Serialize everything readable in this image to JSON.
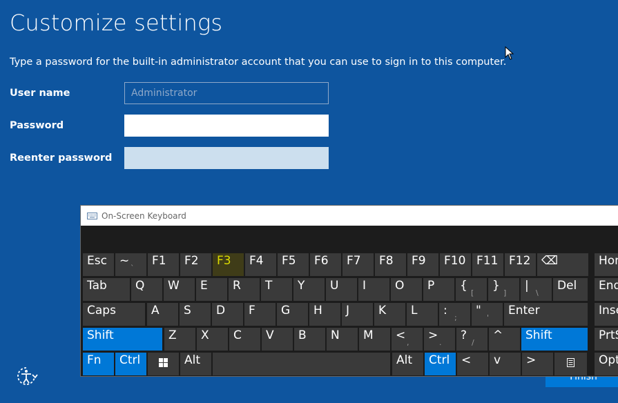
{
  "page": {
    "title": "Customize settings",
    "description": "Type a password for the built-in administrator account that you can use to sign in to this computer."
  },
  "form": {
    "user_label": "User name",
    "user_placeholder": "Administrator",
    "password_label": "Password",
    "password_value": "",
    "reenter_label": "Reenter password",
    "reenter_value": ""
  },
  "finish_label": "Finish",
  "icons": {
    "accessibility": "ease-of-access-icon",
    "cursor": "mouse-pointer-icon"
  },
  "osk": {
    "title": "On-Screen Keyboard",
    "highlighted_key": "F3",
    "rows": [
      [
        {
          "label": "Esc"
        },
        {
          "label": "~",
          "sub": "`"
        },
        {
          "label": "F1"
        },
        {
          "label": "F2"
        },
        {
          "label": "F3",
          "style": "yellow"
        },
        {
          "label": "F4"
        },
        {
          "label": "F5"
        },
        {
          "label": "F6"
        },
        {
          "label": "F7"
        },
        {
          "label": "F8"
        },
        {
          "label": "F9"
        },
        {
          "label": "F10"
        },
        {
          "label": "F11"
        },
        {
          "label": "F12"
        },
        {
          "label": "⌫",
          "name": "backspace"
        },
        {
          "label": "Home"
        }
      ],
      [
        {
          "label": "Tab"
        },
        {
          "label": "Q"
        },
        {
          "label": "W"
        },
        {
          "label": "E"
        },
        {
          "label": "R"
        },
        {
          "label": "T"
        },
        {
          "label": "Y"
        },
        {
          "label": "U"
        },
        {
          "label": "I"
        },
        {
          "label": "O"
        },
        {
          "label": "P"
        },
        {
          "label": "{",
          "sub": "["
        },
        {
          "label": "}",
          "sub": "]"
        },
        {
          "label": "|",
          "sub": "\\"
        },
        {
          "label": "Del"
        },
        {
          "label": "End"
        }
      ],
      [
        {
          "label": "Caps"
        },
        {
          "label": "A"
        },
        {
          "label": "S"
        },
        {
          "label": "D"
        },
        {
          "label": "F"
        },
        {
          "label": "G"
        },
        {
          "label": "H"
        },
        {
          "label": "J"
        },
        {
          "label": "K"
        },
        {
          "label": "L"
        },
        {
          "label": ":",
          "sub": ";"
        },
        {
          "label": "\"",
          "sub": "'"
        },
        {
          "label": "Enter"
        },
        {
          "label": "Insert"
        }
      ],
      [
        {
          "label": "Shift",
          "style": "blue"
        },
        {
          "label": "Z"
        },
        {
          "label": "X"
        },
        {
          "label": "C"
        },
        {
          "label": "V"
        },
        {
          "label": "B"
        },
        {
          "label": "N"
        },
        {
          "label": "M"
        },
        {
          "label": "<",
          "sub": ","
        },
        {
          "label": ">",
          "sub": "."
        },
        {
          "label": "?",
          "sub": "/"
        },
        {
          "label": "^",
          "name": "up-arrow"
        },
        {
          "label": "Shift",
          "style": "blue",
          "name": "right-shift"
        },
        {
          "label": "PrtScn"
        }
      ],
      [
        {
          "label": "Fn",
          "style": "blue"
        },
        {
          "label": "Ctrl",
          "style": "blue"
        },
        {
          "label": "",
          "name": "windows",
          "icon": "windows-logo-icon"
        },
        {
          "label": "Alt"
        },
        {
          "label": "",
          "name": "space"
        },
        {
          "label": "Alt",
          "name": "right-alt"
        },
        {
          "label": "Ctrl",
          "style": "blue",
          "name": "right-ctrl"
        },
        {
          "label": "<",
          "name": "left-arrow"
        },
        {
          "label": "v",
          "name": "down-arrow"
        },
        {
          "label": ">",
          "name": "right-arrow"
        },
        {
          "label": "",
          "name": "context-menu",
          "icon": "menu-key-icon"
        },
        {
          "label": "Options"
        }
      ]
    ]
  }
}
